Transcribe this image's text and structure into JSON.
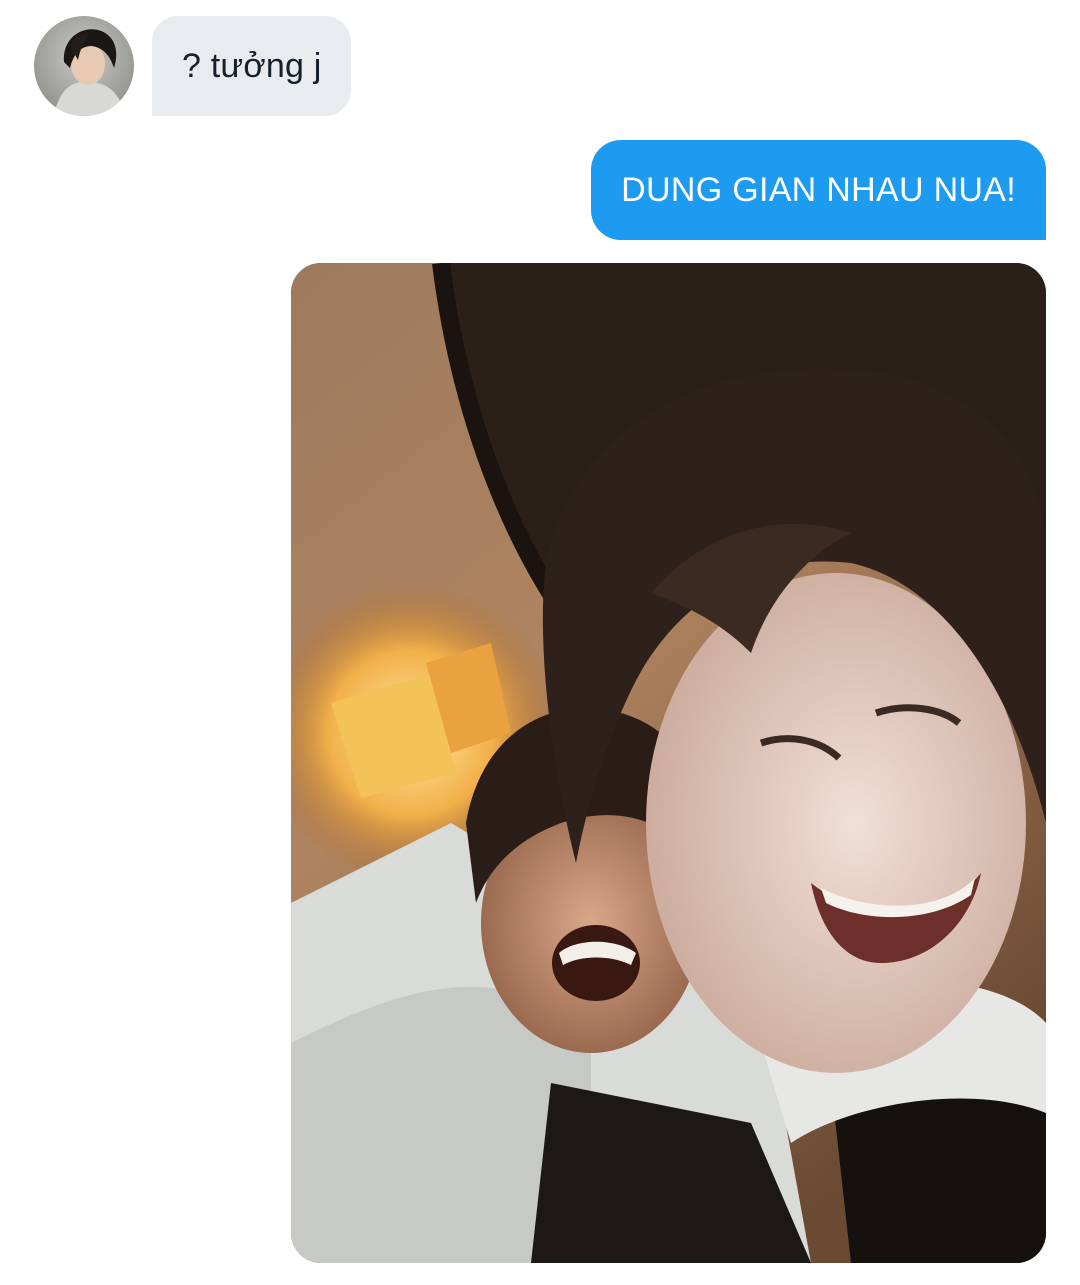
{
  "conversation": {
    "messages": [
      {
        "direction": "incoming",
        "text": "? tưởng j"
      },
      {
        "direction": "outgoing",
        "text": "DUNG GIAN NHAU NUA!"
      },
      {
        "direction": "outgoing",
        "type": "photo"
      }
    ]
  },
  "colors": {
    "incoming_bubble": "#e9ecef",
    "outgoing_bubble": "#1d9bf0",
    "background": "#ffffff"
  },
  "icons": {
    "avatar": "contact-avatar-photo"
  }
}
